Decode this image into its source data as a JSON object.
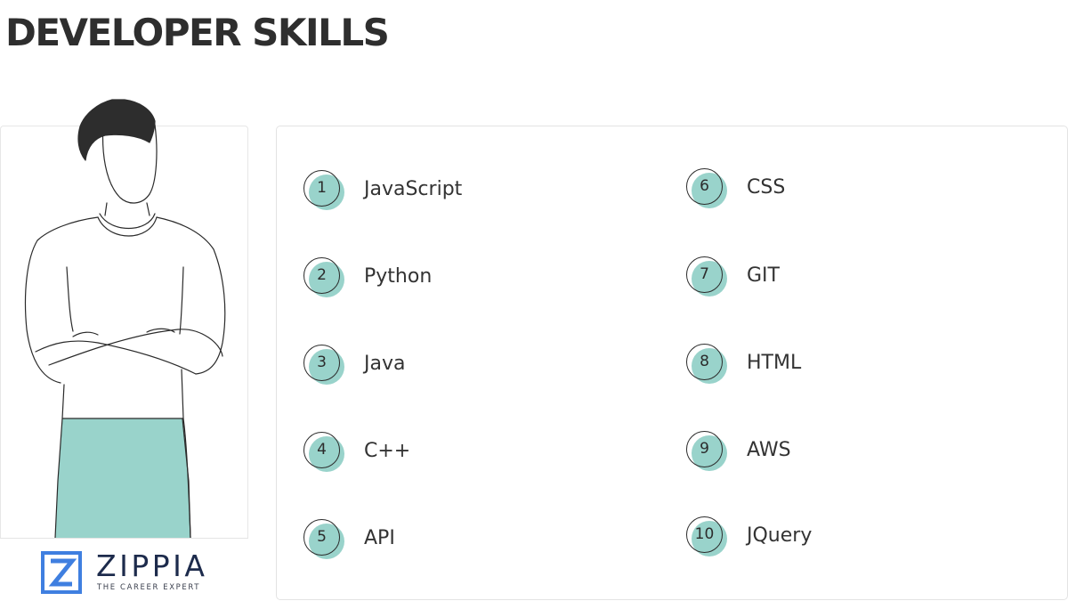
{
  "title": "DEVELOPER SKILLS",
  "brand": {
    "name": "ZIPPIA",
    "tagline": "THE CAREER EXPERT",
    "logo_icon": "zippia-z-logo-icon",
    "logo_color": "#3f7fe0"
  },
  "illustration": {
    "icon": "developer-person-arms-crossed",
    "pants_color": "#99d3cb"
  },
  "accent_color": "#99d3cb",
  "skills": [
    {
      "number": "1",
      "label": "JavaScript"
    },
    {
      "number": "2",
      "label": "Python"
    },
    {
      "number": "3",
      "label": "Java"
    },
    {
      "number": "4",
      "label": "C++"
    },
    {
      "number": "5",
      "label": "API"
    },
    {
      "number": "6",
      "label": "CSS"
    },
    {
      "number": "7",
      "label": "GIT"
    },
    {
      "number": "8",
      "label": "HTML"
    },
    {
      "number": "9",
      "label": "AWS"
    },
    {
      "number": "10",
      "label": "JQuery"
    }
  ]
}
